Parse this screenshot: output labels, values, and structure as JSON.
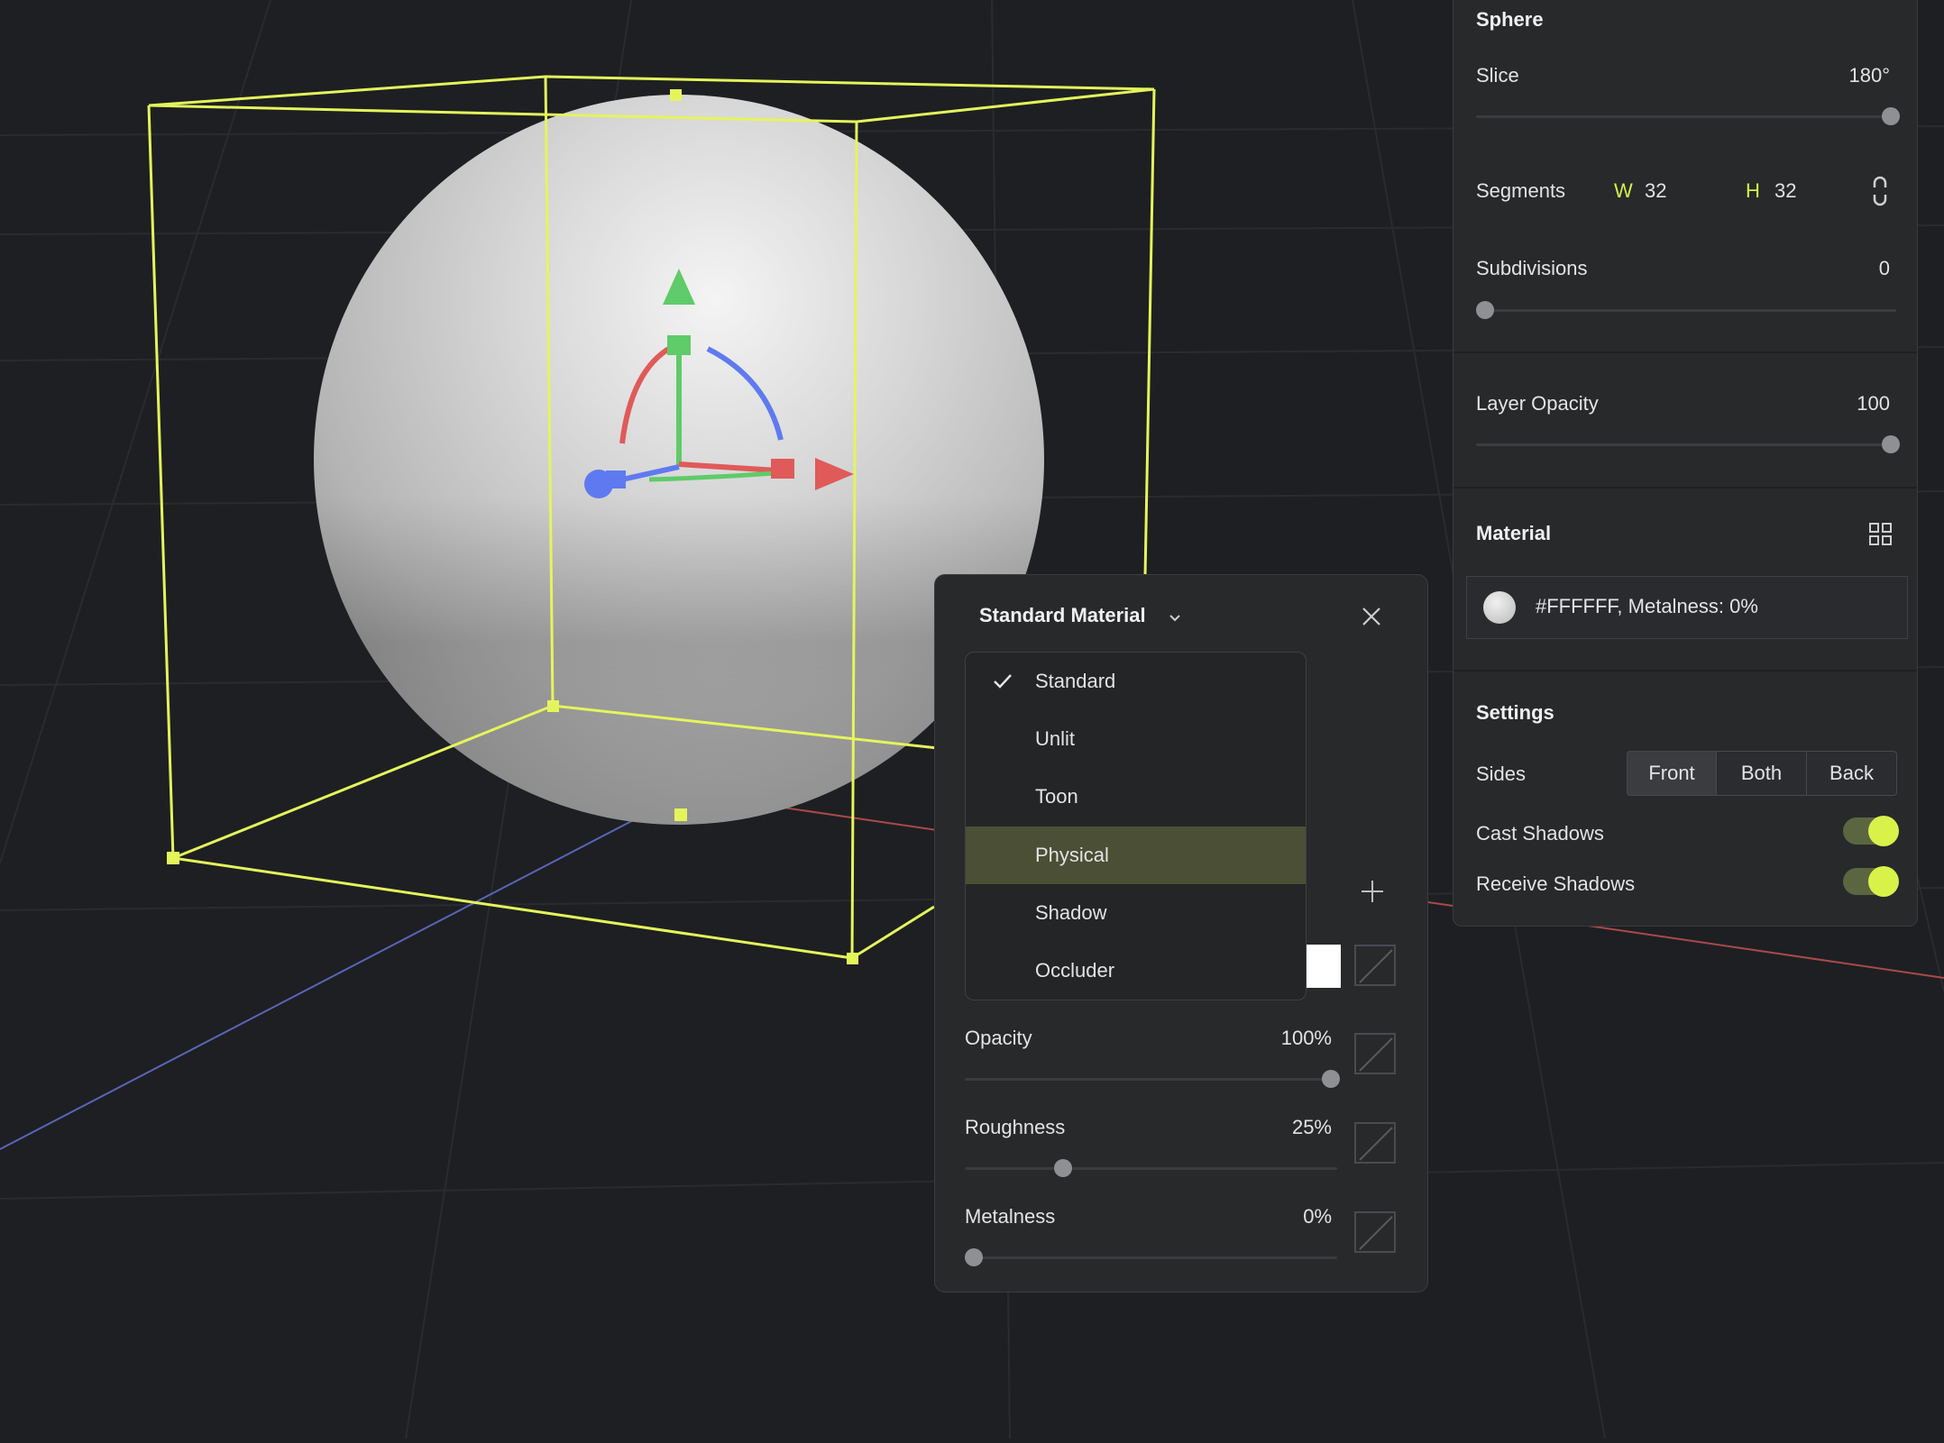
{
  "sphere_panel": {
    "title": "Sphere",
    "slice_label": "Slice",
    "slice_value": "180°",
    "slice_level": 1.0,
    "segments_label": "Segments",
    "seg_w_prefix": "W",
    "seg_w_value": "32",
    "seg_h_prefix": "H",
    "seg_h_value": "32",
    "subdivisions_label": "Subdivisions",
    "subdivisions_value": "0",
    "subdivisions_level": 0.0,
    "layer_opacity_label": "Layer Opacity",
    "layer_opacity_value": "100",
    "layer_opacity_level": 1.0
  },
  "material_section": {
    "title": "Material",
    "summary": "#FFFFFF, Metalness: 0%",
    "swatch_color": "#FFFFFF"
  },
  "settings_section": {
    "title": "Settings",
    "sides_label": "Sides",
    "sides_options": [
      "Front",
      "Both",
      "Back"
    ],
    "sides_selected": "Front",
    "cast_shadows_label": "Cast Shadows",
    "cast_shadows_on": true,
    "receive_shadows_label": "Receive Shadows",
    "receive_shadows_on": true
  },
  "material_popover": {
    "type_label": "Standard Material",
    "dropdown_options": [
      "Standard",
      "Unlit",
      "Toon",
      "Physical",
      "Shadow",
      "Occluder"
    ],
    "checked_option": "Standard",
    "highlighted_option": "Physical",
    "opacity_label": "Opacity",
    "opacity_value": "100%",
    "opacity_level": 1.0,
    "roughness_label": "Roughness",
    "roughness_value": "25%",
    "roughness_level": 0.25,
    "metalness_label": "Metalness",
    "metalness_value": "0%",
    "metalness_level": 0.0
  },
  "colors": {
    "accent": "#D6F04A",
    "selection_box": "#E4F55B",
    "axis_x": "#E05A5A",
    "axis_y": "#5FCB6A",
    "axis_z": "#5F7AF0",
    "highlight_row": "#4A4F35"
  },
  "icons": {
    "dropdown_chevron": "chevron-down-icon",
    "close": "close-icon",
    "check": "check-icon",
    "add": "plus-icon",
    "grid": "grid-icon",
    "link": "link-icon"
  }
}
